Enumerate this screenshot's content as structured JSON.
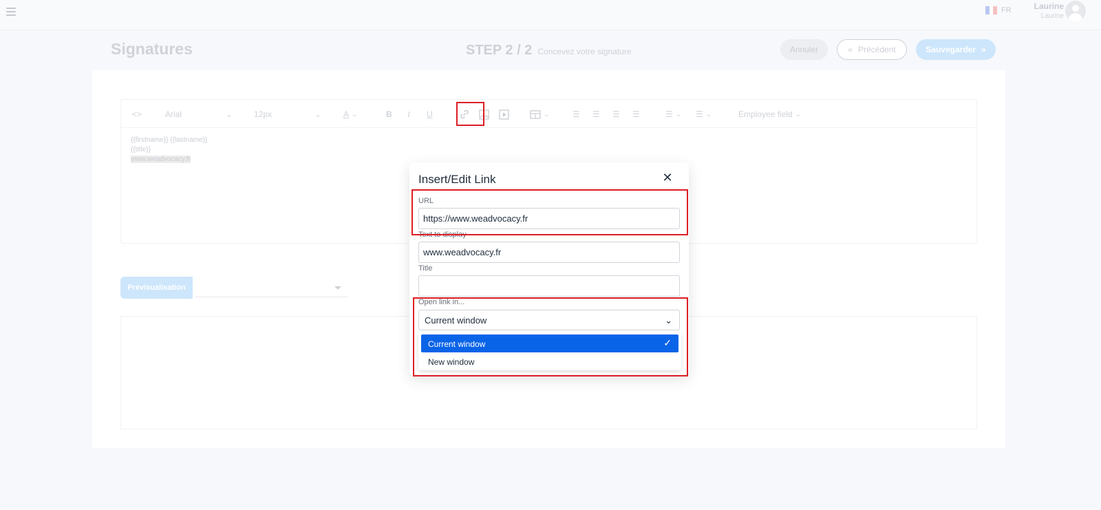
{
  "topbar": {
    "lang_code": "FR",
    "user_name": "Laurine",
    "user_sub": "Laurine"
  },
  "header": {
    "title": "Signatures",
    "step": "STEP 2 / 2",
    "step_desc": "Concevez votre signature",
    "cancel_label": "Annuler",
    "prev_label": "Précédent",
    "save_label": "Sauvegarder"
  },
  "toolbar": {
    "font": "Arial",
    "size": "12px",
    "employee_field": "Employee field"
  },
  "editor": {
    "line1": "{{firstname}} {{lastname}}",
    "line2": "{{title}}",
    "line3": "www.weadvocacy.fr"
  },
  "preview": {
    "button_label": "Prévisualisation"
  },
  "modal": {
    "title": "Insert/Edit Link",
    "url_label": "URL",
    "url_value": "https://www.weadvocacy.fr",
    "text_label": "Text to display",
    "text_value": "www.weadvocacy.fr",
    "title_label": "Title",
    "title_value": "",
    "open_label": "Open link in...",
    "open_value": "Current window",
    "options": [
      "Current window",
      "New window"
    ]
  },
  "colors": {
    "accent": "#0a64e8",
    "highlight": "#dd1c23"
  }
}
